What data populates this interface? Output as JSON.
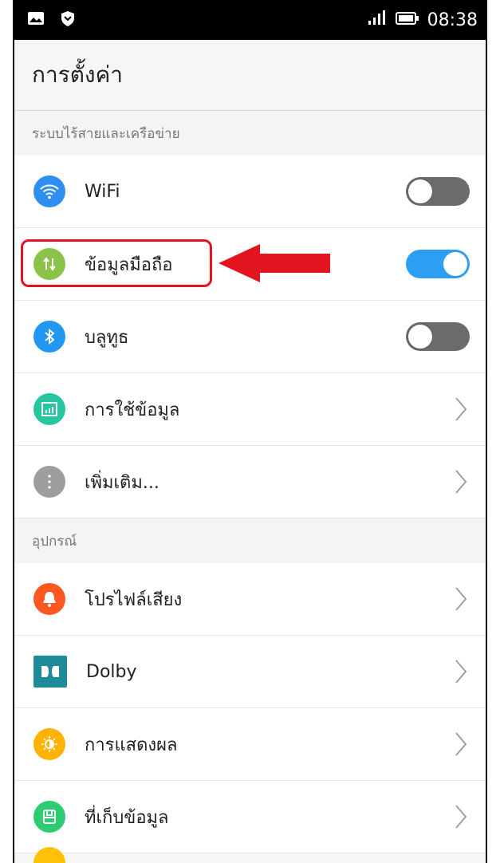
{
  "status_bar": {
    "time": "08:38",
    "left_icons": [
      "image-icon",
      "shield-icon"
    ],
    "right_icons": [
      "signal-icon",
      "battery-icon"
    ]
  },
  "app_bar": {
    "title": "การตั้งค่า"
  },
  "sections": [
    {
      "header": "ระบบไร้สายและเครือข่าย",
      "items": [
        {
          "label": "WiFi",
          "icon": "wifi-icon",
          "icon_color": "#2e8ff0",
          "control": "toggle",
          "state": "off"
        },
        {
          "label": "ข้อมูลมือถือ",
          "icon": "mobile-data-icon",
          "icon_color": "#8bc34a",
          "control": "toggle",
          "state": "on",
          "highlighted": true
        },
        {
          "label": "บลูทูธ",
          "icon": "bluetooth-icon",
          "icon_color": "#2196f3",
          "control": "toggle",
          "state": "off"
        },
        {
          "label": "การใช้ข้อมูล",
          "icon": "data-usage-icon",
          "icon_color": "#26c6a0",
          "control": "chevron"
        },
        {
          "label": "เพิ่มเติม...",
          "icon": "more-icon",
          "icon_color": "#9e9e9e",
          "control": "chevron"
        }
      ]
    },
    {
      "header": "อุปกรณ์",
      "items": [
        {
          "label": "โปรไฟล์เสียง",
          "icon": "bell-icon",
          "icon_color": "#ff5722",
          "control": "chevron"
        },
        {
          "label": "Dolby",
          "icon": "dolby-icon",
          "icon_color": "#1e8a9a",
          "control": "chevron"
        },
        {
          "label": "การแสดงผล",
          "icon": "display-icon",
          "icon_color": "#ffb300",
          "control": "chevron"
        },
        {
          "label": "ที่เก็บข้อมูล",
          "icon": "storage-icon",
          "icon_color": "#2ecc71",
          "control": "chevron"
        }
      ]
    }
  ],
  "annotation": {
    "highlight_color": "#e2141f"
  }
}
